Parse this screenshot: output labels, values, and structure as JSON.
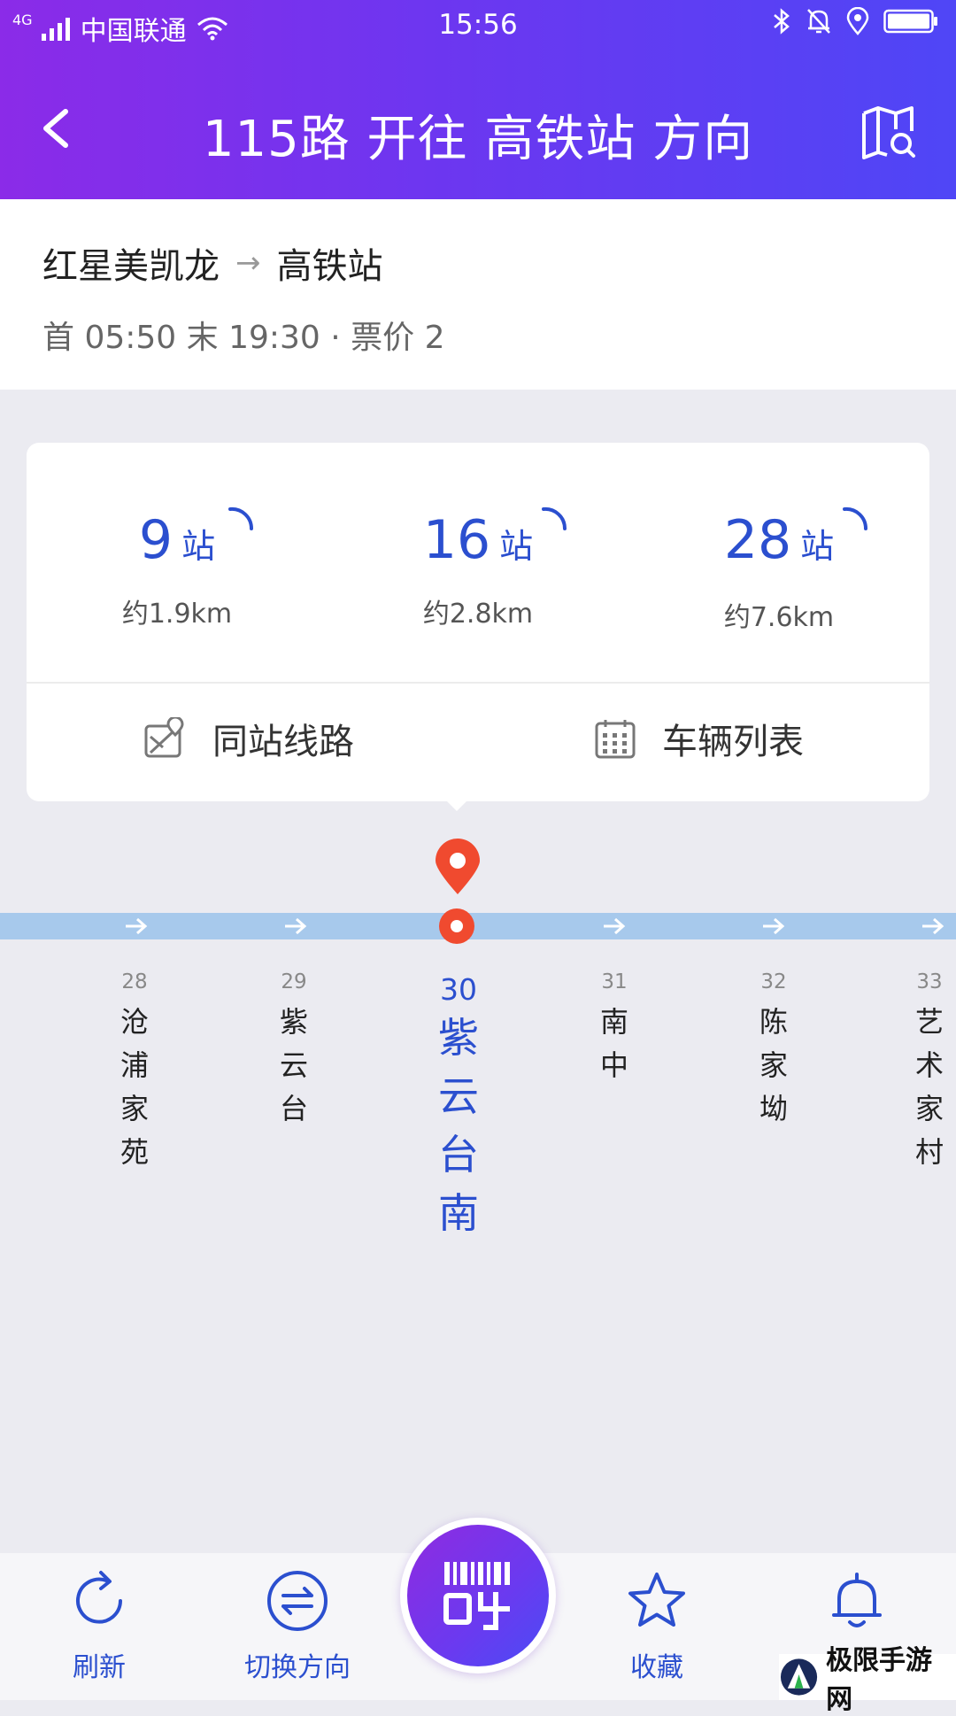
{
  "status_bar": {
    "network": "4G",
    "carrier": "中国联通",
    "time": "15:56"
  },
  "header": {
    "title": "115路 开往 高铁站 方向"
  },
  "summary": {
    "from": "红星美凯龙",
    "to": "高铁站",
    "info": "首 05:50 末 19:30 · 票价 2"
  },
  "arrivals": [
    {
      "stops": "9",
      "unit": "站",
      "distance": "约1.9km"
    },
    {
      "stops": "16",
      "unit": "站",
      "distance": "约2.8km"
    },
    {
      "stops": "28",
      "unit": "站",
      "distance": "约7.6km"
    }
  ],
  "card_actions": {
    "same_station": "同站线路",
    "vehicle_list": "车辆列表"
  },
  "stations": [
    {
      "index": "28",
      "name": "沧浦家苑"
    },
    {
      "index": "29",
      "name": "紫云台"
    },
    {
      "index": "30",
      "name": "紫云台南"
    },
    {
      "index": "31",
      "name": "南中"
    },
    {
      "index": "32",
      "name": "陈家坳"
    },
    {
      "index": "33",
      "name": "艺术家村"
    }
  ],
  "bottom_bar": {
    "refresh": "刷新",
    "switch_direction": "切换方向",
    "favorite": "收藏"
  },
  "watermark": "极限手游网",
  "colors": {
    "header_start": "#8b2be8",
    "header_end": "#4f46f6",
    "accent_blue": "#2b4fcf",
    "marker_red": "#f04a2f",
    "line_blue": "#a7c9ec"
  }
}
